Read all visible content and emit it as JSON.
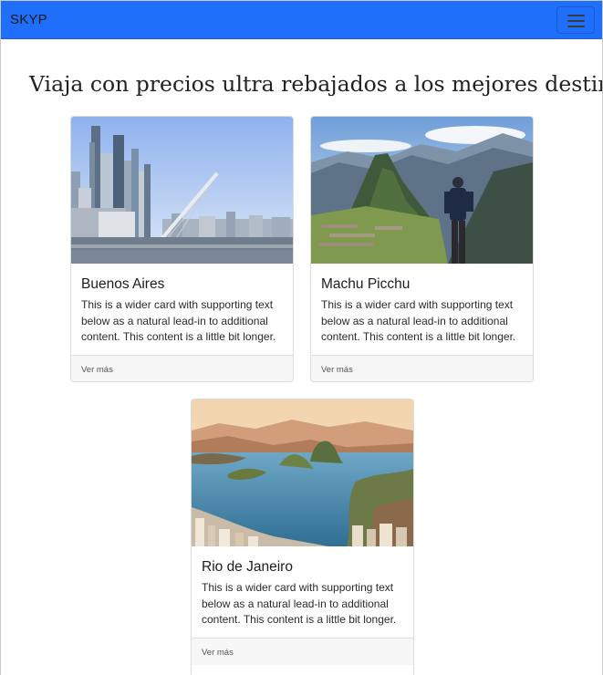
{
  "navbar": {
    "brand": "SKYP",
    "toggler_icon": "hamburger-menu-icon",
    "color": "#1f6ffb"
  },
  "hero": {
    "title": "Viaja con precios ultra rebajados a los mejores destinos"
  },
  "cards": [
    {
      "title": "Buenos Aires",
      "text": "This is a wider card with supporting text below as a natural lead-in to additional content. This content is a little bit longer.",
      "link": "Ver más",
      "image": "buenos-aires-skyline-photo"
    },
    {
      "title": "Machu Picchu",
      "text": "This is a wider card with supporting text below as a natural lead-in to additional content. This content is a little bit longer.",
      "link": "Ver más",
      "image": "machu-picchu-mountain-photo"
    },
    {
      "title": "Rio de Janeiro",
      "text": "This is a wider card with supporting text below as a natural lead-in to additional content. This content is a little bit longer.",
      "link": "Ver más",
      "image": "rio-de-janeiro-bay-photo"
    }
  ]
}
